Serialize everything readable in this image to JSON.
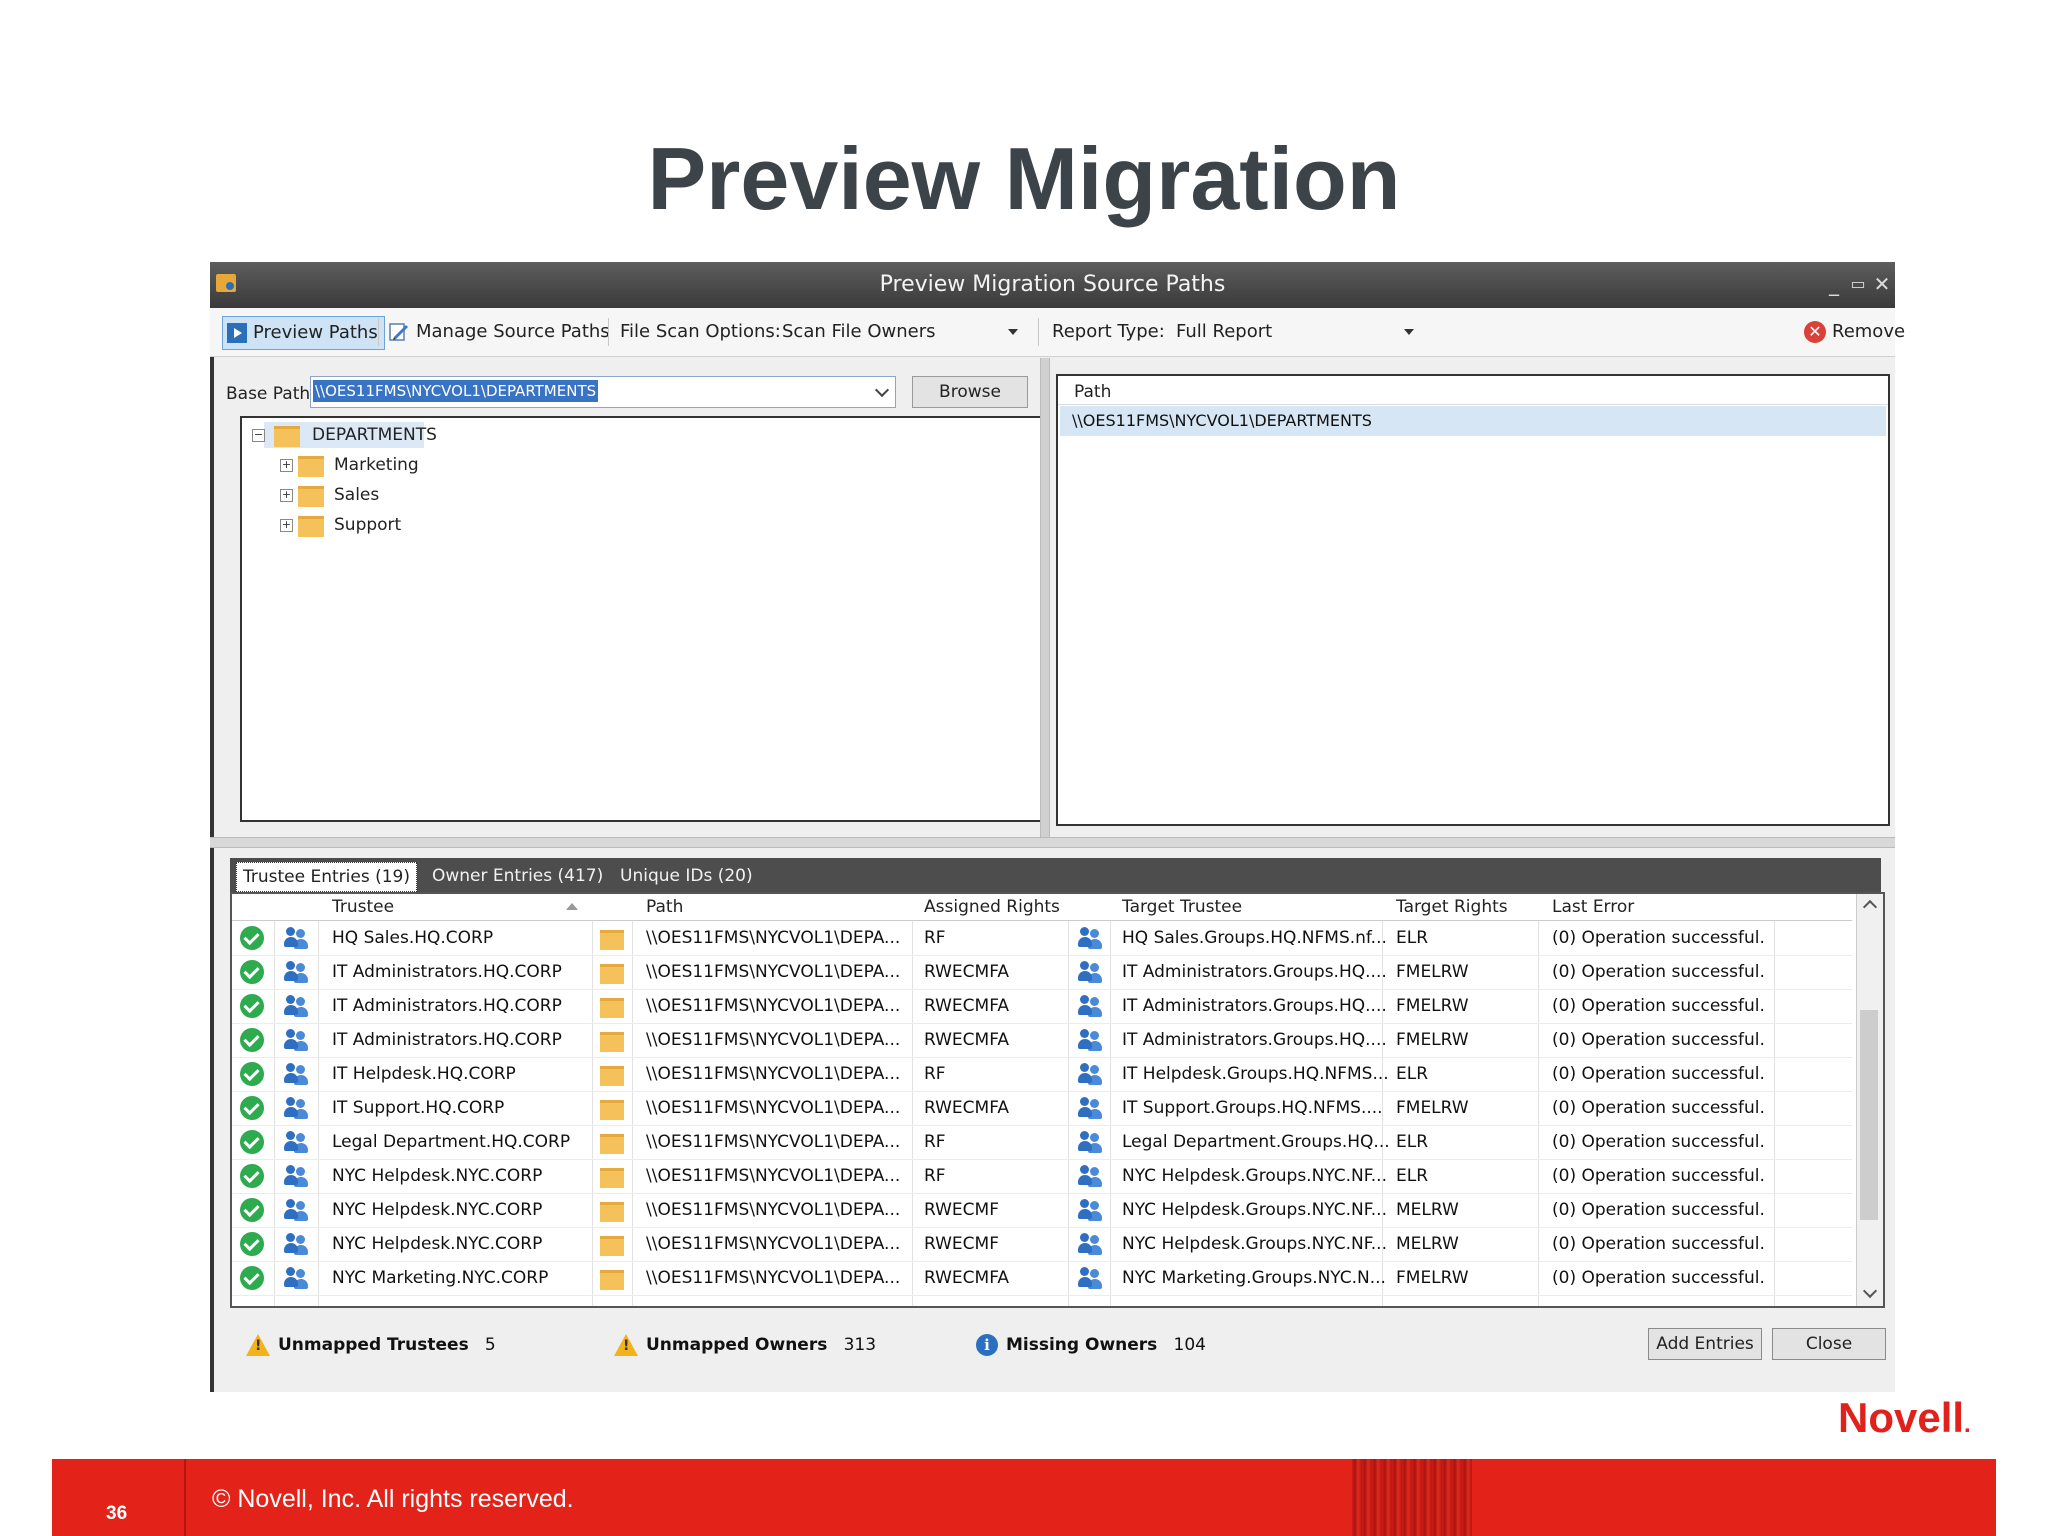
{
  "slide": {
    "title": "Preview Migration",
    "page_number": "36",
    "copyright": "© Novell, Inc.  All rights reserved.",
    "logo": "Novell",
    "logo_mark": "."
  },
  "window": {
    "title": "Preview Migration Source Paths",
    "minimize": "_",
    "maximize": "▭",
    "close": "✕"
  },
  "toolbar": {
    "preview_paths": "Preview Paths",
    "manage_source_paths": "Manage Source Paths",
    "file_scan_label": "File Scan Options:",
    "file_scan_value": "Scan File Owners",
    "report_type_label": "Report Type:",
    "report_type_value": "Full Report",
    "remove": "Remove"
  },
  "base_path": {
    "label": "Base Path",
    "value": "\\\\OES11FMS\\NYCVOL1\\DEPARTMENTS",
    "browse": "Browse"
  },
  "tree": {
    "root": "DEPARTMENTS",
    "children": [
      "Marketing",
      "Sales",
      "Support"
    ]
  },
  "path_list": {
    "header": "Path",
    "rows": [
      "\\\\OES11FMS\\NYCVOL1\\DEPARTMENTS"
    ]
  },
  "tabs": [
    {
      "label": "Trustee Entries  (19)"
    },
    {
      "label": "Owner Entries  (417)"
    },
    {
      "label": "Unique IDs  (20)"
    }
  ],
  "grid": {
    "headers": {
      "trustee": "Trustee",
      "path": "Path",
      "assigned_rights": "Assigned Rights",
      "target_trustee": "Target Trustee",
      "target_rights": "Target Rights",
      "last_error": "Last Error"
    },
    "rows": [
      {
        "trustee": "HQ Sales.HQ.CORP",
        "path": "\\\\OES11FMS\\NYCVOL1\\DEPA...",
        "rights": "RF",
        "target": "HQ Sales.Groups.HQ.NFMS.nf...",
        "trights": "ELR",
        "error": "(0)  Operation successful."
      },
      {
        "trustee": "IT Administrators.HQ.CORP",
        "path": "\\\\OES11FMS\\NYCVOL1\\DEPA...",
        "rights": "RWECMFA",
        "target": "IT Administrators.Groups.HQ....",
        "trights": "FMELRW",
        "error": "(0)  Operation successful."
      },
      {
        "trustee": "IT Administrators.HQ.CORP",
        "path": "\\\\OES11FMS\\NYCVOL1\\DEPA...",
        "rights": "RWECMFA",
        "target": "IT Administrators.Groups.HQ....",
        "trights": "FMELRW",
        "error": "(0)  Operation successful."
      },
      {
        "trustee": "IT Administrators.HQ.CORP",
        "path": "\\\\OES11FMS\\NYCVOL1\\DEPA...",
        "rights": "RWECMFA",
        "target": "IT Administrators.Groups.HQ....",
        "trights": "FMELRW",
        "error": "(0)  Operation successful."
      },
      {
        "trustee": "IT Helpdesk.HQ.CORP",
        "path": "\\\\OES11FMS\\NYCVOL1\\DEPA...",
        "rights": "RF",
        "target": "IT Helpdesk.Groups.HQ.NFMS...",
        "trights": "ELR",
        "error": "(0)  Operation successful."
      },
      {
        "trustee": "IT Support.HQ.CORP",
        "path": "\\\\OES11FMS\\NYCVOL1\\DEPA...",
        "rights": "RWECMFA",
        "target": "IT Support.Groups.HQ.NFMS....",
        "trights": "FMELRW",
        "error": "(0)  Operation successful."
      },
      {
        "trustee": "Legal Department.HQ.CORP",
        "path": "\\\\OES11FMS\\NYCVOL1\\DEPA...",
        "rights": "RF",
        "target": "Legal Department.Groups.HQ...",
        "trights": "ELR",
        "error": "(0)  Operation successful."
      },
      {
        "trustee": "NYC Helpdesk.NYC.CORP",
        "path": "\\\\OES11FMS\\NYCVOL1\\DEPA...",
        "rights": "RF",
        "target": "NYC Helpdesk.Groups.NYC.NF...",
        "trights": "ELR",
        "error": "(0)  Operation successful."
      },
      {
        "trustee": "NYC Helpdesk.NYC.CORP",
        "path": "\\\\OES11FMS\\NYCVOL1\\DEPA...",
        "rights": "RWECMF",
        "target": "NYC Helpdesk.Groups.NYC.NF...",
        "trights": "MELRW",
        "error": "(0)  Operation successful."
      },
      {
        "trustee": "NYC Helpdesk.NYC.CORP",
        "path": "\\\\OES11FMS\\NYCVOL1\\DEPA...",
        "rights": "RWECMF",
        "target": "NYC Helpdesk.Groups.NYC.NF...",
        "trights": "MELRW",
        "error": "(0)  Operation successful."
      },
      {
        "trustee": "NYC Marketing.NYC.CORP",
        "path": "\\\\OES11FMS\\NYCVOL1\\DEPA...",
        "rights": "RWECMFA",
        "target": "NYC Marketing.Groups.NYC.N...",
        "trights": "FMELRW",
        "error": "(0)  Operation successful."
      }
    ]
  },
  "status": {
    "unmapped_trustees_label": "Unmapped Trustees",
    "unmapped_trustees_count": "5",
    "unmapped_owners_label": "Unmapped Owners",
    "unmapped_owners_count": "313",
    "missing_owners_label": "Missing Owners",
    "missing_owners_count": "104",
    "info_glyph": "i",
    "add_entries": "Add Entries",
    "close": "Close"
  },
  "colors": {
    "accent": "#e3231a",
    "selection": "#3873c4",
    "success": "#2eaa4f"
  }
}
